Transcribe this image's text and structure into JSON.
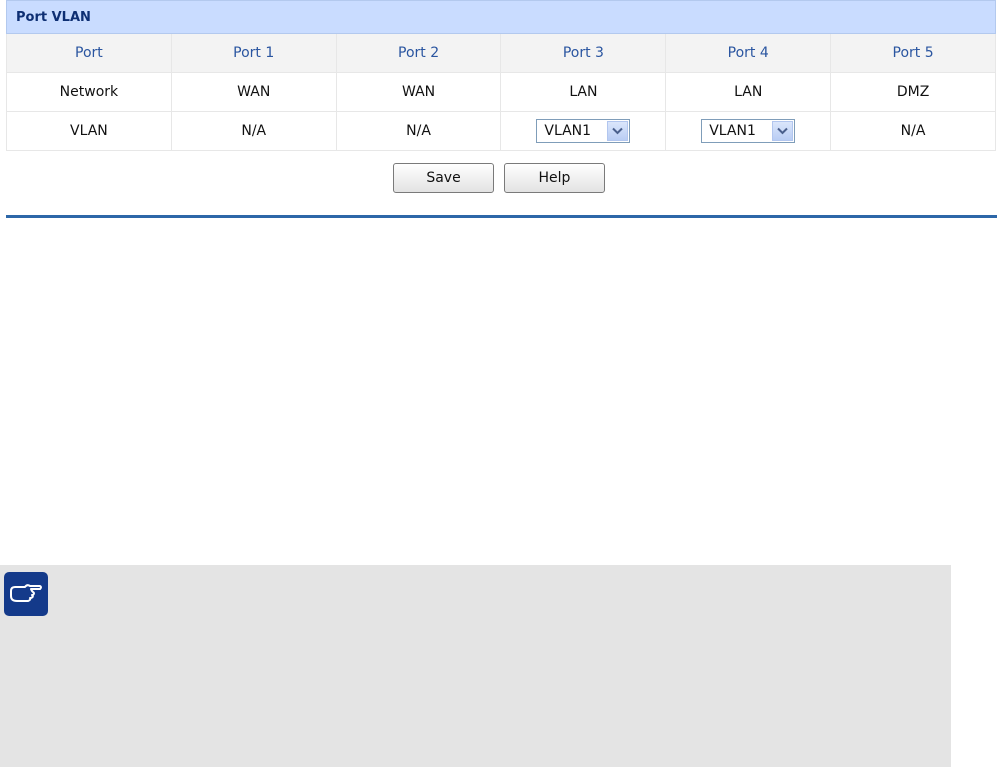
{
  "panel": {
    "title": "Port VLAN"
  },
  "table": {
    "headers": [
      "Port",
      "Port 1",
      "Port 2",
      "Port 3",
      "Port 4",
      "Port 5"
    ],
    "network_row": [
      "Network",
      "WAN",
      "WAN",
      "LAN",
      "LAN",
      "DMZ"
    ],
    "vlan_row": {
      "label": "VLAN",
      "port1": "N/A",
      "port2": "N/A",
      "port3_selected": "VLAN1",
      "port4_selected": "VLAN1",
      "port5": "N/A"
    }
  },
  "buttons": {
    "save_label": "Save",
    "help_label": "Help"
  },
  "icons": {
    "note": "pointing-hand-icon",
    "dropdown": "chevron-down-icon"
  },
  "colors": {
    "header_bg": "#c9dcff",
    "header_text": "#0e2f73",
    "column_header_text": "#2a55a0",
    "rule": "#2d67a8",
    "note_bg": "#e4e4e4",
    "note_icon_bg": "#143a8a"
  }
}
